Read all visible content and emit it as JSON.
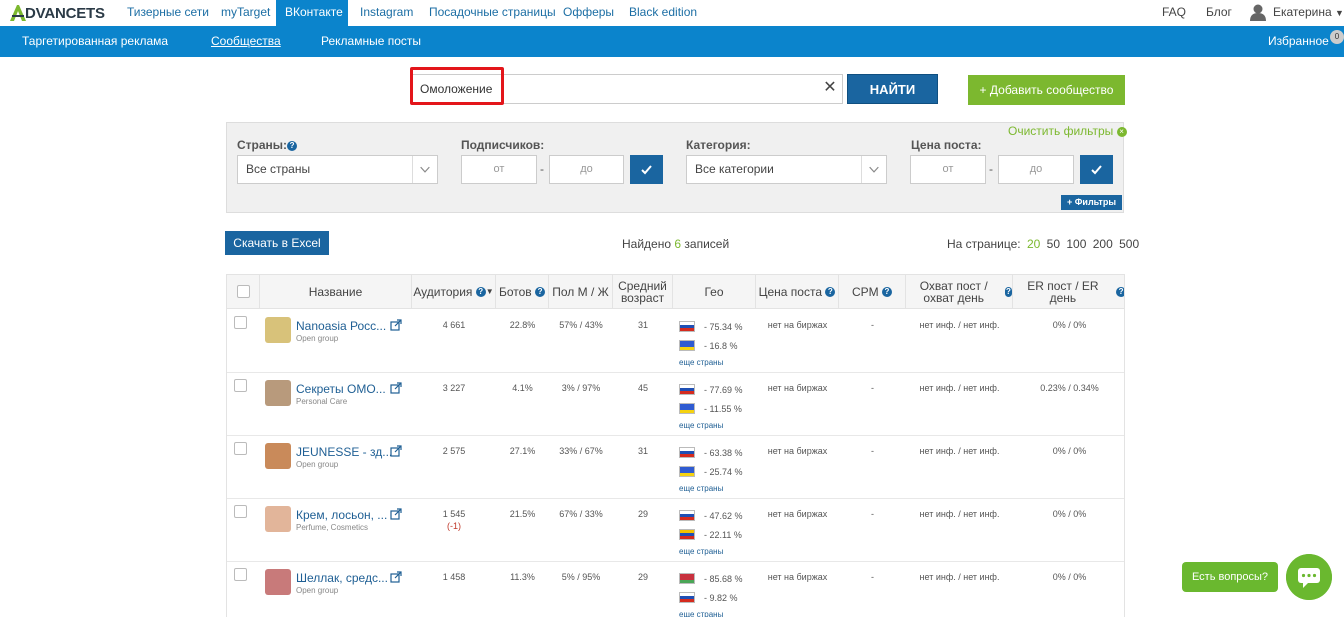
{
  "brand": {
    "logo_letter": "A",
    "logo_text": "DVANCETS"
  },
  "topnav": {
    "items": [
      {
        "label": "Тизерные сети",
        "active": false
      },
      {
        "label": "myTarget",
        "active": false
      },
      {
        "label": "ВКонтакте",
        "active": true
      },
      {
        "label": "Instagram",
        "active": false
      },
      {
        "label": "Посадочные страницы",
        "active": false
      },
      {
        "label": "Офферы",
        "active": false
      },
      {
        "label": "Black edition",
        "active": false
      }
    ],
    "faq": "FAQ",
    "blog": "Блог",
    "user_name": "Екатерина"
  },
  "subnav": {
    "items": [
      {
        "label": "Таргетированная реклама",
        "active": false
      },
      {
        "label": "Сообщества",
        "active": true
      },
      {
        "label": "Рекламные посты",
        "active": false
      }
    ],
    "favorites": "Избранное",
    "favorites_count": "0"
  },
  "search": {
    "value": "Омоложение",
    "button": "НАЙТИ",
    "clear": "✕"
  },
  "add_community": "+ Добавить сообщество",
  "filters": {
    "clear": "Очистить фильтры",
    "countries_label": "Страны:",
    "countries_value": "Все страны",
    "subscribers_label": "Подписчиков:",
    "from": "от",
    "to": "до",
    "category_label": "Категория:",
    "category_value": "Все категории",
    "price_label": "Цена поста:",
    "more": "+ Фильтры"
  },
  "results": {
    "excel": "Скачать в Excel",
    "found_prefix": "Найдено",
    "found_count": "6",
    "found_suffix": "записей",
    "per_page_label": "На странице:",
    "per_page_options": [
      "20",
      "50",
      "100",
      "200",
      "500"
    ],
    "per_page_active": "20"
  },
  "table": {
    "headers": {
      "name": "Название",
      "audience": "Аудитория",
      "bots": "Ботов",
      "gender": "Пол М / Ж",
      "age": "Средний возраст",
      "geo": "Гео",
      "price": "Цена поста",
      "cpm": "CPM",
      "reach": "Охват пост / охват день",
      "er": "ER пост / ER день"
    },
    "rows": [
      {
        "name": "Nanoasia Росс...",
        "category": "Open group",
        "audience": "4 661",
        "delta": "",
        "bots": "22.8%",
        "gender": "57% / 43%",
        "age": "31",
        "geo": [
          {
            "flag": "ru",
            "pct": "- 75.34 %"
          },
          {
            "flag": "ua",
            "pct": "- 16.8 %"
          }
        ],
        "geo_more": "еще страны",
        "price": "нет на биржах",
        "cpm": "-",
        "reach": "нет инф. / нет инф.",
        "er": "0% / 0%",
        "avatar_color": "#d8c27a"
      },
      {
        "name": "Секреты ОМО...",
        "category": "Personal Care",
        "audience": "3 227",
        "delta": "",
        "bots": "4.1%",
        "gender": "3% / 97%",
        "age": "45",
        "geo": [
          {
            "flag": "ru",
            "pct": "- 77.69 %"
          },
          {
            "flag": "ua",
            "pct": "- 11.55 %"
          }
        ],
        "geo_more": "еще страны",
        "price": "нет на биржах",
        "cpm": "-",
        "reach": "нет инф. / нет инф.",
        "er": "0.23% / 0.34%",
        "avatar_color": "#b89a7c"
      },
      {
        "name": "JEUNESSE - зд...",
        "category": "Open group",
        "audience": "2 575",
        "delta": "",
        "bots": "27.1%",
        "gender": "33% / 67%",
        "age": "31",
        "geo": [
          {
            "flag": "ru",
            "pct": "- 63.38 %"
          },
          {
            "flag": "ua",
            "pct": "- 25.74 %"
          }
        ],
        "geo_more": "еще страны",
        "price": "нет на биржах",
        "cpm": "-",
        "reach": "нет инф. / нет инф.",
        "er": "0% / 0%",
        "avatar_color": "#c98a5a"
      },
      {
        "name": "Крем, лосьон, ...",
        "category": "Perfume, Cosmetics",
        "audience": "1 545",
        "delta": "(-1)",
        "bots": "21.5%",
        "gender": "67% / 33%",
        "age": "29",
        "geo": [
          {
            "flag": "ru",
            "pct": "- 47.62 %"
          },
          {
            "flag": "ve",
            "pct": "- 22.11 %"
          }
        ],
        "geo_more": "еще страны",
        "price": "нет на биржах",
        "cpm": "-",
        "reach": "нет инф. / нет инф.",
        "er": "0% / 0%",
        "avatar_color": "#e2b59a"
      },
      {
        "name": "Шеллак, средс...",
        "category": "Open group",
        "audience": "1 458",
        "delta": "",
        "bots": "11.3%",
        "gender": "5% / 95%",
        "age": "29",
        "geo": [
          {
            "flag": "by",
            "pct": "- 85.68 %"
          },
          {
            "flag": "ru",
            "pct": "- 9.82 %"
          }
        ],
        "geo_more": "еще страны",
        "price": "нет на биржах",
        "cpm": "-",
        "reach": "нет инф. / нет инф.",
        "er": "0% / 0%",
        "avatar_color": "#c87a7a"
      }
    ]
  },
  "chat": {
    "question": "Есть вопросы?"
  },
  "colors": {
    "accent_blue": "#0b84cc",
    "dark_blue": "#1a65a0",
    "green": "#7cb82f",
    "red_highlight": "#e3151a"
  }
}
